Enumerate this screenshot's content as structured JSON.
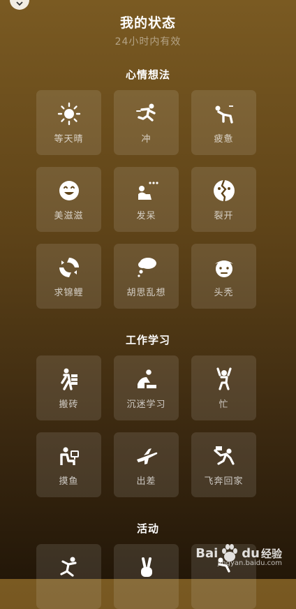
{
  "header": {
    "title": "我的状态",
    "subtitle": "24小时内有效"
  },
  "sections": [
    {
      "title": "心情想法",
      "items": [
        {
          "label": "等天晴",
          "icon": "sun-icon"
        },
        {
          "label": "冲",
          "icon": "running-icon"
        },
        {
          "label": "疲惫",
          "icon": "exhausted-icon"
        },
        {
          "label": "美滋滋",
          "icon": "smile-icon"
        },
        {
          "label": "发呆",
          "icon": "daze-icon"
        },
        {
          "label": "裂开",
          "icon": "cracked-icon"
        },
        {
          "label": "求锦鲤",
          "icon": "koi-icon"
        },
        {
          "label": "胡思乱想",
          "icon": "thought-cloud-icon"
        },
        {
          "label": "头秃",
          "icon": "bald-head-icon"
        }
      ]
    },
    {
      "title": "工作学习",
      "items": [
        {
          "label": "搬砖",
          "icon": "brick-carrier-icon"
        },
        {
          "label": "沉迷学习",
          "icon": "studying-icon"
        },
        {
          "label": "忙",
          "icon": "busy-icon"
        },
        {
          "label": "摸鱼",
          "icon": "slacking-icon"
        },
        {
          "label": "出差",
          "icon": "airplane-icon"
        },
        {
          "label": "飞奔回家",
          "icon": "rushing-home-icon"
        }
      ]
    },
    {
      "title": "活动",
      "items": [
        {
          "label": "",
          "icon": "dancing-icon"
        },
        {
          "label": "",
          "icon": "victory-hand-icon"
        },
        {
          "label": "",
          "icon": "activity-icon"
        }
      ]
    }
  ],
  "watermark": {
    "brand": "Bai",
    "brand2": "du",
    "suffix": "经验",
    "url": "jingyan.baidu.com"
  }
}
